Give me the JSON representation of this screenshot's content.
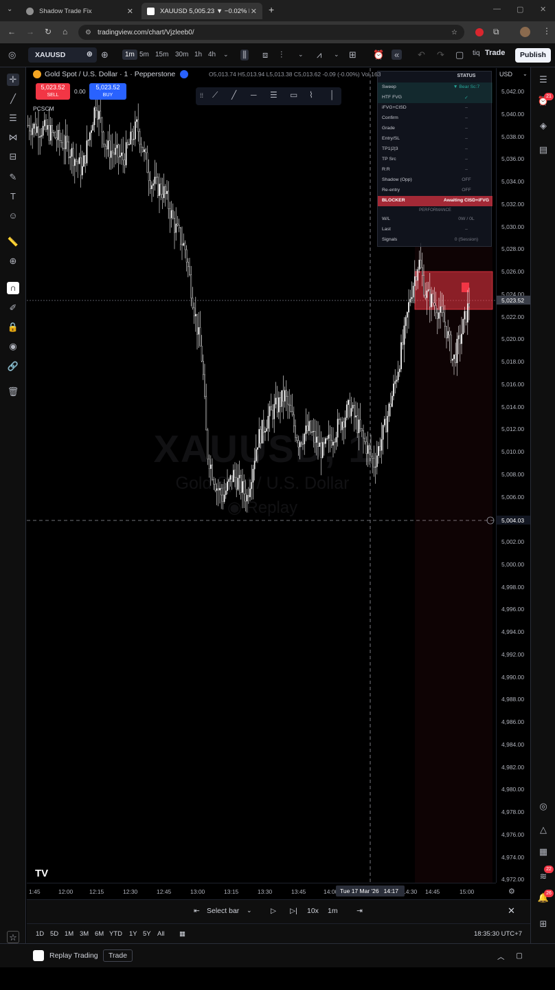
{
  "browser": {
    "tabs": [
      {
        "title": "Shadow Trade Fix",
        "favicon_color": "#8f8f8f",
        "active": false
      },
      {
        "title": "XAUUSD 5,005.23 ▼ −0.02% lo...",
        "favicon_color": "#ffffff",
        "active": true
      }
    ],
    "new_tab": "+",
    "url": "tradingview.com/chart/Vjzleeb0/"
  },
  "toolbar": {
    "symbol": "XAUUSD",
    "timeframes": [
      "1m",
      "5m",
      "15m",
      "30m",
      "1h",
      "4h"
    ],
    "selected_timeframe": "1m",
    "trade_label": "Trade",
    "publish_label": "Publish"
  },
  "legend": {
    "title": "Gold Spot / U.S. Dollar · 1 · Pepperstone",
    "ohlc": "O5,013.74 H5,013.94 L5,013.38 C5,013.62 -0.09 (-0.00%)",
    "vol": "Vol 163",
    "sell_price": "5,023.52",
    "sell_label": "SELL",
    "buy_price": "5,023.52",
    "buy_label": "BUY",
    "spread": "0.00",
    "indicator": "PCSCM"
  },
  "watermark": {
    "symbol": "XAUUSD, 1",
    "name": "Gold Spot / U.S. Dollar",
    "mode": "Replay"
  },
  "status_table": {
    "header": "STATUS",
    "rows": [
      {
        "key": "Sweep",
        "value": "▼ Bear Sc:7"
      },
      {
        "key": "HTF FVG",
        "value": "✓"
      },
      {
        "key": "iFVG+CISD",
        "value": "–"
      },
      {
        "key": "Confirm",
        "value": "–"
      },
      {
        "key": "Grade",
        "value": "–"
      },
      {
        "key": "Entry/SL",
        "value": "–"
      },
      {
        "key": "TP1|2|3",
        "value": "–"
      },
      {
        "key": "TP Src",
        "value": "–"
      },
      {
        "key": "R:R",
        "value": "–"
      },
      {
        "key": "Shadow (Opp)",
        "value": "OFF"
      },
      {
        "key": "Re-entry",
        "value": "OFF"
      },
      {
        "key": "BLOCKER",
        "value": "Awaiting CISD+iFVG"
      }
    ],
    "performance_label": "PERFORMANCE",
    "perf_rows": [
      {
        "key": "W/L",
        "value": "0W / 0L"
      },
      {
        "key": "Last",
        "value": "–"
      },
      {
        "key": "Signals",
        "value": "0 (Session)"
      }
    ]
  },
  "price_axis": {
    "currency": "USD",
    "labels": [
      "5,042.00",
      "5,040.00",
      "5,038.00",
      "5,036.00",
      "5,034.00",
      "5,032.00",
      "5,030.00",
      "5,028.00",
      "5,026.00",
      "5,024.00",
      "5,022.00",
      "5,020.00",
      "5,018.00",
      "5,016.00",
      "5,014.00",
      "5,012.00",
      "5,010.00",
      "5,008.00",
      "5,006.00",
      "5,004.00",
      "5,002.00",
      "5,000.00",
      "4,998.00",
      "4,996.00",
      "4,994.00",
      "4,992.00",
      "4,990.00",
      "4,988.00",
      "4,986.00",
      "4,984.00",
      "4,982.00",
      "4,980.00",
      "4,978.00",
      "4,976.00",
      "4,974.00",
      "4,972.00"
    ],
    "current_price": "5,023.52",
    "crosshair_price": "5,004.03"
  },
  "time_axis": {
    "labels": [
      "1:45",
      "12:00",
      "12:15",
      "12:30",
      "12:45",
      "13:00",
      "13:15",
      "13:30",
      "13:45",
      "14:00",
      "14:30",
      "14:45",
      "15:00"
    ],
    "crosshair_time": "Tue 17 Mar '26   14:17"
  },
  "replay_bar": {
    "select_bar": "Select bar",
    "speed": "10x",
    "interval": "1m"
  },
  "range_bar": {
    "ranges": [
      "1D",
      "5D",
      "1M",
      "3M",
      "6M",
      "YTD",
      "1Y",
      "5Y",
      "All"
    ],
    "time": "18:35:30 UTC+7"
  },
  "footer": {
    "replay_trading": "Replay Trading",
    "trade": "Trade"
  },
  "right_badges": {
    "alerts": "21",
    "notifications_a": "22",
    "notifications_b": "26"
  },
  "colors": {
    "sell": "#f23645",
    "buy": "#2962ff",
    "zone": "#f23645",
    "candles": "#ffffff"
  }
}
